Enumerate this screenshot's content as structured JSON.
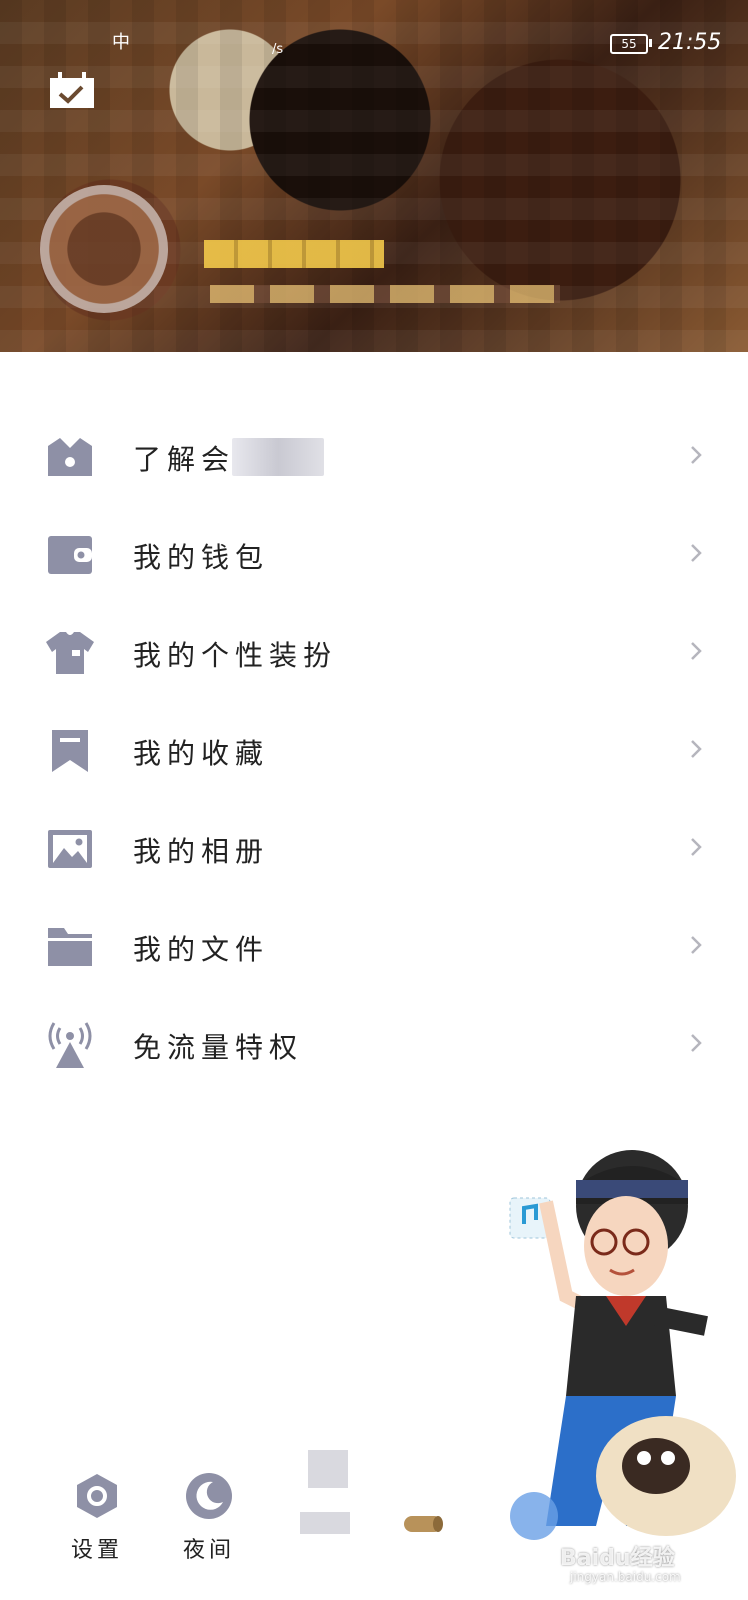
{
  "status_bar": {
    "left_fragment": "中",
    "speed_unit": "/s",
    "battery": "55",
    "time": "21:55"
  },
  "menu": {
    "items": [
      {
        "label": "了解会",
        "icon": "crown-icon"
      },
      {
        "label": "我的钱包",
        "icon": "wallet-icon"
      },
      {
        "label": "我的个性装扮",
        "icon": "tshirt-icon"
      },
      {
        "label": "我的收藏",
        "icon": "bookmark-icon"
      },
      {
        "label": "我的相册",
        "icon": "photo-album-icon"
      },
      {
        "label": "我的文件",
        "icon": "folder-icon"
      },
      {
        "label": "免流量特权",
        "icon": "signal-tower-icon"
      }
    ]
  },
  "bottom_bar": {
    "settings_label": "设置",
    "night_label": "夜间"
  },
  "watermark": {
    "brand": "Baidu经验",
    "url": "jingyan.baidu.com"
  },
  "colors": {
    "icon_gray": "#8e90a6",
    "arrow_gray": "#b5b5bd",
    "text": "#222222"
  }
}
